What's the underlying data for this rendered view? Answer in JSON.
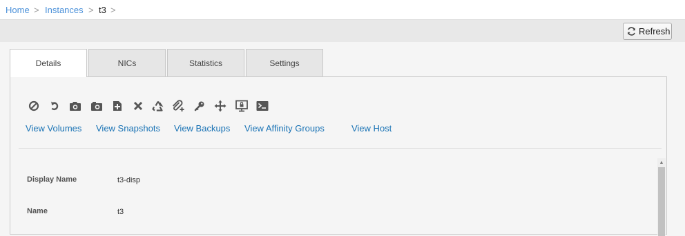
{
  "breadcrumb": {
    "items": [
      "Home",
      "Instances",
      "t3"
    ],
    "separator": ">"
  },
  "toolbar": {
    "refresh_label": "Refresh",
    "refresh_icon": "refresh-icon"
  },
  "tabs": [
    {
      "label": "Details",
      "active": true
    },
    {
      "label": "NICs",
      "active": false
    },
    {
      "label": "Statistics",
      "active": false
    },
    {
      "label": "Settings",
      "active": false
    }
  ],
  "actions": [
    "stop-icon",
    "reboot-icon",
    "snapshot-icon",
    "vm-snapshot-icon",
    "attach-iso-icon",
    "destroy-icon",
    "reinstall-icon",
    "add-attachment-icon",
    "reset-ssh-key-icon",
    "migrate-icon",
    "view-console-icon",
    "terminal-icon"
  ],
  "links": {
    "volumes": "View Volumes",
    "snapshots": "View Snapshots",
    "backups": "View Backups",
    "affinity_groups": "View Affinity Groups",
    "host": "View Host"
  },
  "details": [
    {
      "label": "Display Name",
      "value": "t3-disp"
    },
    {
      "label": "Name",
      "value": "t3"
    }
  ],
  "colors": {
    "link": "#1a73b5",
    "breadcrumb_link": "#4a90d9",
    "icon": "#555555"
  }
}
